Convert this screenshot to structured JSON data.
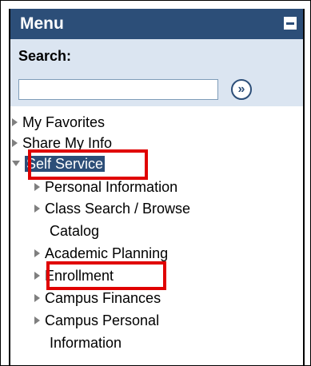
{
  "menu": {
    "title": "Menu",
    "collapse_icon": "minus-icon"
  },
  "search": {
    "label": "Search:",
    "input_value": "",
    "go_icon": "double-chevron-right-icon",
    "go_symbol": "»"
  },
  "nav": {
    "my_favorites": "My Favorites",
    "share_my_info": "Share My Info",
    "self_service": "Self Service",
    "children": {
      "personal_information": "Personal Information",
      "class_search_line1": "Class Search / Browse",
      "class_search_line2": "Catalog",
      "academic_planning": "Academic Planning",
      "enrollment": "Enrollment",
      "campus_finances": "Campus Finances",
      "campus_personal_line1": "Campus Personal",
      "campus_personal_line2": "Information"
    }
  },
  "colors": {
    "header": "#2c4e78",
    "search_bg": "#dbe5f1",
    "highlight": "#e00000"
  }
}
